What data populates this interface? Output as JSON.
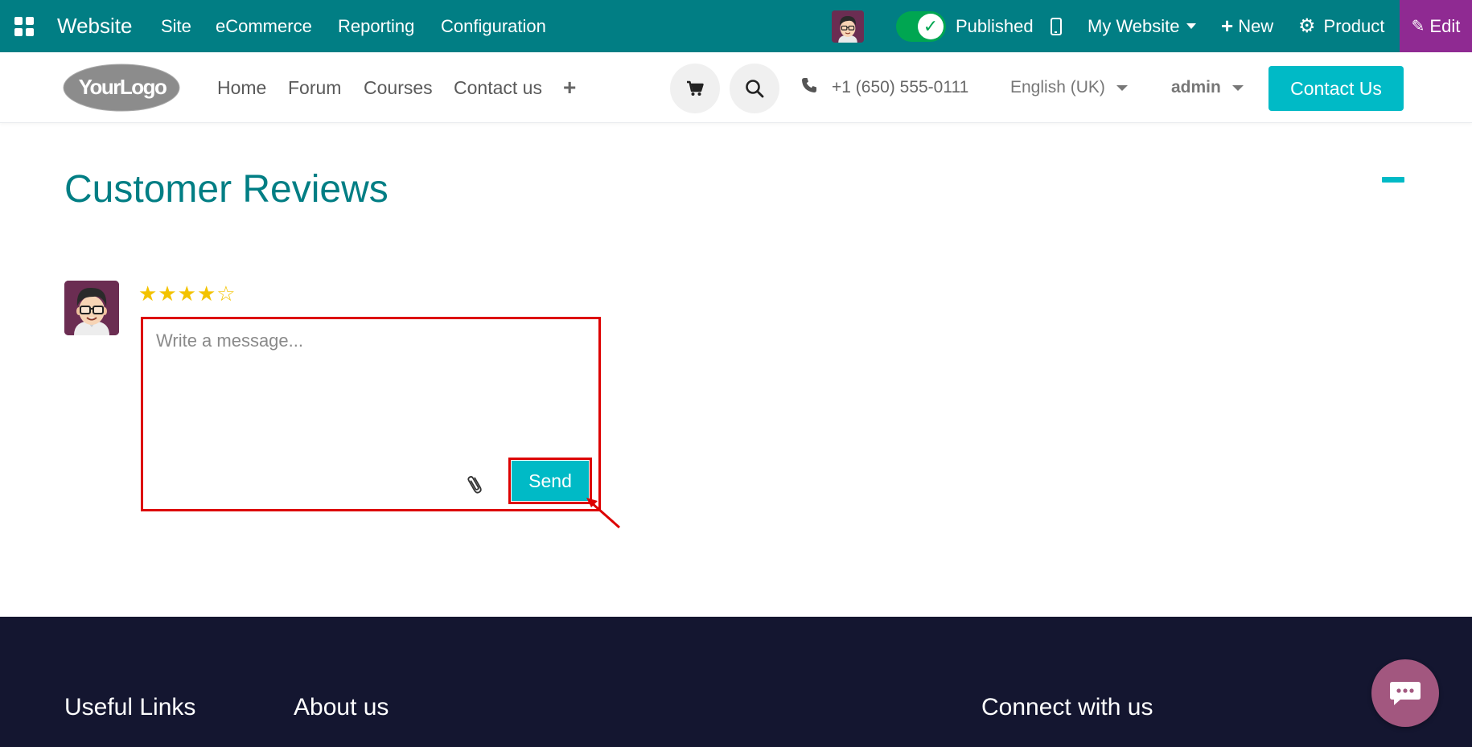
{
  "admin_bar": {
    "brand": "Website",
    "menu": [
      "Site",
      "eCommerce",
      "Reporting",
      "Configuration"
    ],
    "publish_label": "Published",
    "website_selector": "My Website",
    "new_label": "New",
    "product_label": "Product",
    "edit_label": "Edit",
    "colors": {
      "bar": "#017e84",
      "edit": "#8f2a92",
      "published_toggle": "#00a651"
    }
  },
  "header": {
    "logo_text": "YourLogo",
    "nav": [
      "Home",
      "Forum",
      "Courses",
      "Contact us"
    ],
    "phone": "+1 (650) 555-0111",
    "language": "English (UK)",
    "user": "admin",
    "cta_label": "Contact Us",
    "colors": {
      "cta": "#00bac6"
    }
  },
  "main": {
    "title": "Customer Reviews",
    "rating": {
      "value": 4,
      "max": 5
    },
    "composer": {
      "placeholder": "Write a message...",
      "value": "",
      "send_label": "Send"
    },
    "colors": {
      "title": "#017e84",
      "highlight": "#dd0000",
      "stars": "#f3c300"
    }
  },
  "footer": {
    "headings": [
      "Useful Links",
      "About us",
      "Connect with us"
    ],
    "colors": {
      "background": "#141630",
      "chat": "#a2577f"
    }
  },
  "icons": [
    "apps-icon",
    "mobile-preview-icon",
    "plus-icon",
    "gear-icon",
    "pencil-icon",
    "cart-icon",
    "search-icon",
    "phone-icon",
    "paperclip-icon",
    "chat-icon"
  ]
}
